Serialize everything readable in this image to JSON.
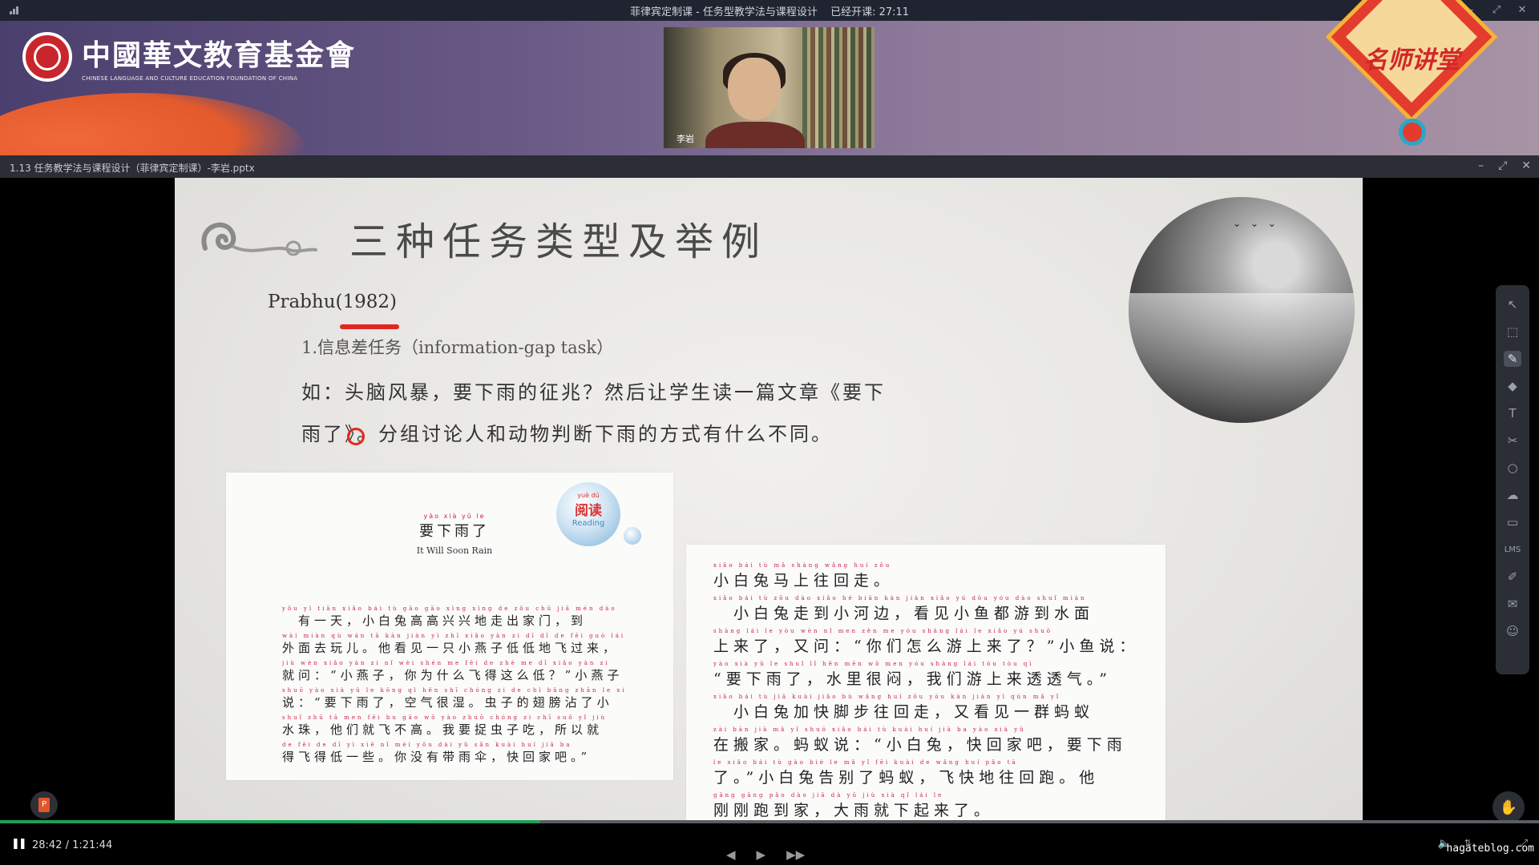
{
  "topbar": {
    "course_title": "菲律宾定制课 - 任务型教学法与课程设计",
    "elapsed_label": "已经开课: 27:11"
  },
  "banner": {
    "org_name_cn": "中國華文教育基金會",
    "org_name_en": "CHINESE LANGUAGE AND CULTURE EDUCATION FOUNDATION OF CHINA",
    "badge_text": "名师讲堂",
    "presenter_name": "李岩"
  },
  "file": {
    "name": "1.13 任务教学法与课程设计（菲律宾定制课）-李岩.pptx"
  },
  "slide": {
    "title": "三种任务类型及举例",
    "author": "Prabhu(1982)",
    "item1": "1.信息差任务（information-gap task）",
    "para_lines": [
      "如：头脑风暴，要下雨的征兆？然后让学生读一篇文章《要下",
      "雨了》。分组讨论人和动物判断下雨的方式有什么不同。"
    ],
    "reading_badge": {
      "py": "yuè dú",
      "cn": "阅读",
      "en": "Reading"
    },
    "story_title": {
      "py": "yào xià yǔ le",
      "cn": "要下雨了",
      "en": "It Will Soon Rain"
    },
    "story_left": [
      {
        "py": "yǒu yì tiān xiǎo bái tù gāo gāo xìng xìng de zǒu chū jiā mén dào",
        "cn": "　有一天，小白兔高高兴兴地走出家门，到"
      },
      {
        "py": "wài miàn qù wán tā kàn jiàn yì zhī xiǎo yàn zi dī dī de fēi guò lái",
        "cn": "外面去玩儿。他看见一只小燕子低低地飞过来，"
      },
      {
        "py": "jiù wèn xiǎo yàn zi nǐ wèi shén me fēi de zhè me dī xiǎo yàn zi",
        "cn": "就问：“小燕子，你为什么飞得这么低？”小燕子"
      },
      {
        "py": "shuō yào xià yǔ le kōng qì hěn shī chóng zi de chì bǎng zhān le xiǎo",
        "cn": "说：“要下雨了，空气很湿。虫子的翅膀沾了小"
      },
      {
        "py": "shuǐ zhū tā men fēi bu gāo wǒ yào zhuō chóng zi chī suǒ yǐ jiù",
        "cn": "水珠，他们就飞不高。我要捉虫子吃，所以就"
      },
      {
        "py": "de fēi de dī yì xiē nǐ méi yǒu dài yǔ sǎn kuài huí jiā ba",
        "cn": "得飞得低一些。你没有带雨伞，快回家吧。”"
      }
    ],
    "story_right": [
      {
        "py": "xiǎo bái tù mǎ shàng wǎng huí zǒu",
        "cn": "小白兔马上往回走。"
      },
      {
        "py": "xiǎo bái tù zǒu dào xiǎo hé biān kàn jiàn xiǎo yú dōu yóu dào shuǐ miàn",
        "cn": "　小白兔走到小河边，看见小鱼都游到水面"
      },
      {
        "py": "shàng lái le yòu wèn nǐ men zěn me yóu shàng lái le xiǎo yú shuō",
        "cn": "上来了，又问：“你们怎么游上来了？”小鱼说："
      },
      {
        "py": "yào xià yǔ le shuǐ lǐ hěn mēn wǒ men yóu shàng lái tòu tòu qì",
        "cn": "“要下雨了，水里很闷，我们游上来透透气。”"
      },
      {
        "py": "xiǎo bái tù jiā kuài jiǎo bù wǎng huí zǒu yòu kàn jiàn yì qún mǎ yǐ",
        "cn": "　小白兔加快脚步往回走，又看见一群蚂蚁"
      },
      {
        "py": "zài bān jiā mǎ yǐ shuō xiǎo bái tù kuài huí jiā ba yào xià yǔ",
        "cn": "在搬家。蚂蚁说：“小白兔，快回家吧，要下雨"
      },
      {
        "py": "le xiǎo bái tù gào bié le mǎ yǐ fēi kuài de wǎng huí pǎo tā",
        "cn": "了。”小白兔告别了蚂蚁，飞快地往回跑。他"
      },
      {
        "py": "gāng gāng pǎo dào jiā dà yǔ jiù xià qǐ lái le",
        "cn": "刚刚跑到家，大雨就下起来了。"
      }
    ]
  },
  "tools": {
    "lms_label": "LMS"
  },
  "player": {
    "time_label": "28:42 / 1:21:44",
    "progress_fraction": 0.351,
    "progress_color": "#1f9f5a"
  },
  "watermark": "hagateblog.com",
  "colors": {
    "accent_red": "#e0261f",
    "badge_red": "#e33b2d"
  }
}
